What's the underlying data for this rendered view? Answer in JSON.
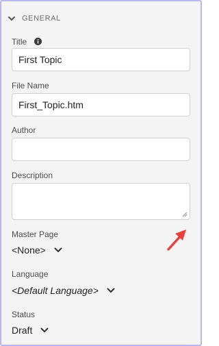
{
  "section": {
    "title": "GENERAL",
    "icon": "chevron-down-icon"
  },
  "fields": {
    "title": {
      "label": "Title",
      "value": "First Topic",
      "info_icon": "info-icon"
    },
    "file_name": {
      "label": "File Name",
      "value": "First_Topic.htm"
    },
    "author": {
      "label": "Author",
      "value": ""
    },
    "description": {
      "label": "Description",
      "value": ""
    }
  },
  "dropdowns": {
    "master_page": {
      "label": "Master Page",
      "selected": "<None>"
    },
    "language": {
      "label": "Language",
      "selected": "<Default Language>"
    },
    "status": {
      "label": "Status",
      "selected": "Draft"
    }
  },
  "annotation": {
    "icon": "red-arrow-icon",
    "color": "#e8413b"
  },
  "colors": {
    "panel_border": "#b8b8f0",
    "panel_bg": "#f4f4f4"
  }
}
